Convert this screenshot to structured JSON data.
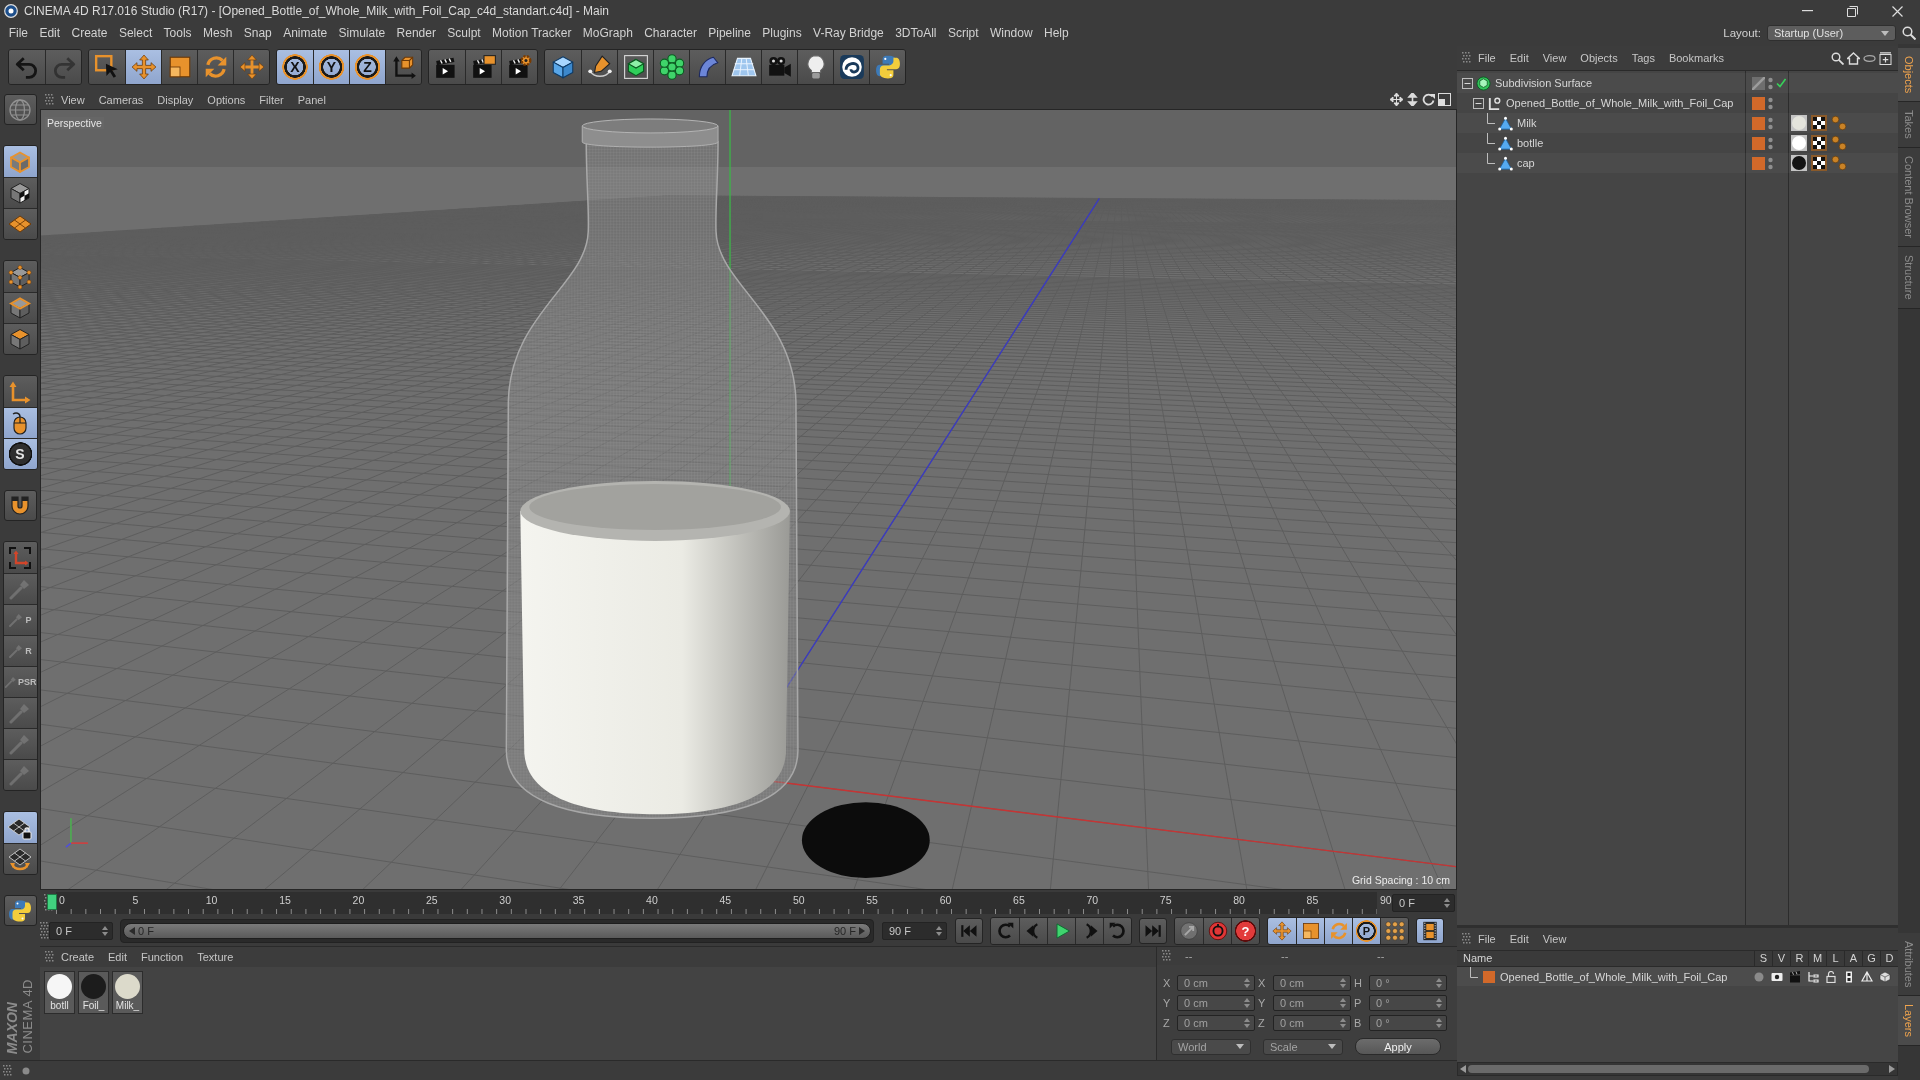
{
  "window": {
    "title": "CINEMA 4D R17.016 Studio (R17) - [Opened_Bottle_of_Whole_Milk_with_Foil_Cap_c4d_standart.c4d] - Main"
  },
  "menu_bar": {
    "items": [
      "File",
      "Edit",
      "Create",
      "Select",
      "Tools",
      "Mesh",
      "Snap",
      "Animate",
      "Simulate",
      "Render",
      "Sculpt",
      "Motion Tracker",
      "MoGraph",
      "Character",
      "Pipeline",
      "Plugins",
      "V-Ray Bridge",
      "3DToAll",
      "Script",
      "Window",
      "Help"
    ],
    "layout_label": "Layout:",
    "layout_value": "Startup (User)"
  },
  "toolbar": [
    {
      "buttons": [
        {
          "kind": "undo",
          "selected": false,
          "disabled": false
        },
        {
          "kind": "redo",
          "selected": false,
          "disabled": true
        }
      ]
    },
    {
      "buttons": [
        {
          "kind": "select",
          "selected": false,
          "disabled": false
        },
        {
          "kind": "move",
          "selected": true,
          "disabled": false
        },
        {
          "kind": "scale",
          "selected": false,
          "disabled": false
        },
        {
          "kind": "rotate",
          "selected": false,
          "disabled": false
        },
        {
          "kind": "transform",
          "selected": false,
          "disabled": false
        }
      ]
    },
    {
      "buttons": [
        {
          "kind": "axis",
          "label": "X",
          "selected": true,
          "disabled": false
        },
        {
          "kind": "axis",
          "label": "Y",
          "selected": true,
          "disabled": false
        },
        {
          "kind": "axis",
          "label": "Z",
          "selected": true,
          "disabled": false
        },
        {
          "kind": "coords",
          "selected": false,
          "disabled": false
        }
      ]
    },
    {
      "buttons": [
        {
          "kind": "render_view",
          "selected": false,
          "disabled": false
        },
        {
          "kind": "render_picture",
          "selected": false,
          "disabled": false
        },
        {
          "kind": "render_settings",
          "selected": false,
          "disabled": false
        }
      ]
    },
    {
      "buttons": [
        {
          "kind": "cube",
          "selected": false,
          "disabled": false
        },
        {
          "kind": "pen",
          "selected": false,
          "disabled": false
        },
        {
          "kind": "subdivision",
          "selected": false,
          "disabled": false
        },
        {
          "kind": "cloner",
          "selected": false,
          "disabled": false
        },
        {
          "kind": "deformer",
          "selected": false,
          "disabled": false
        },
        {
          "kind": "floor",
          "selected": false,
          "disabled": false
        },
        {
          "kind": "camera",
          "selected": false,
          "disabled": false
        },
        {
          "kind": "light",
          "selected": false,
          "disabled": false
        },
        {
          "kind": "plugin",
          "selected": false,
          "disabled": false
        },
        {
          "kind": "python",
          "selected": false,
          "disabled": false
        }
      ]
    }
  ],
  "tool_palette": [
    {
      "buttons": [
        {
          "kind": "editable",
          "selected": false,
          "disabled": true
        }
      ]
    },
    {
      "buttons": [
        {
          "kind": "model",
          "selected": true,
          "disabled": false
        },
        {
          "kind": "texture",
          "selected": false,
          "disabled": false
        },
        {
          "kind": "workplane",
          "selected": false,
          "disabled": false
        }
      ]
    },
    {
      "buttons": [
        {
          "kind": "points",
          "selected": false,
          "disabled": false
        },
        {
          "kind": "edges",
          "selected": false,
          "disabled": false
        },
        {
          "kind": "polygons",
          "selected": false,
          "disabled": false
        }
      ]
    },
    {
      "buttons": [
        {
          "kind": "axis_mode",
          "selected": false,
          "disabled": false
        },
        {
          "kind": "tweak",
          "selected": true,
          "disabled": false
        },
        {
          "kind": "solo",
          "label": "S",
          "selected": true,
          "disabled": false
        }
      ]
    },
    {
      "buttons": [
        {
          "kind": "snap",
          "selected": false,
          "disabled": false
        }
      ]
    },
    {
      "buttons": [
        {
          "kind": "workplane_axis",
          "selected": false,
          "disabled": false
        },
        {
          "kind": "brush",
          "selected": false,
          "disabled": true
        },
        {
          "kind": "brush",
          "label": "P",
          "selected": false,
          "disabled": true
        },
        {
          "kind": "brush",
          "label": "R",
          "selected": false,
          "disabled": true
        },
        {
          "kind": "brush",
          "label": "PSR",
          "selected": false,
          "disabled": true
        },
        {
          "kind": "brush",
          "selected": false,
          "disabled": true
        },
        {
          "kind": "brush",
          "selected": false,
          "disabled": true
        },
        {
          "kind": "brush",
          "selected": false,
          "disabled": true
        }
      ]
    },
    {
      "buttons": [
        {
          "kind": "lock_workplane",
          "selected": true,
          "disabled": false
        },
        {
          "kind": "planar",
          "selected": false,
          "disabled": false
        }
      ]
    },
    {
      "buttons": [
        {
          "kind": "python",
          "selected": false,
          "disabled": false
        }
      ]
    }
  ],
  "logo": {
    "brand": "MAXON",
    "product": "CINEMA 4D"
  },
  "viewport": {
    "menu": [
      "View",
      "Cameras",
      "Display",
      "Options",
      "Filter",
      "Panel"
    ],
    "camera_label": "Perspective",
    "grid_spacing": "Grid Spacing : 10 cm"
  },
  "timeline": {
    "ticks": [
      "0",
      "5",
      "10",
      "15",
      "20",
      "25",
      "30",
      "35",
      "40",
      "45",
      "50",
      "55",
      "60",
      "65",
      "70",
      "75",
      "80",
      "85",
      "90"
    ],
    "playhead": {
      "level": 0
    },
    "current_frame": "0 F",
    "start_field": "0 F",
    "range": {
      "start": "0 F",
      "end": "90 F",
      "level": 1
    },
    "end_field": "90 F",
    "transport": [
      {
        "buttons": [
          {
            "kind": "first",
            "selected": false,
            "disabled": false
          }
        ]
      },
      {
        "buttons": [
          {
            "kind": "prev_key",
            "selected": false,
            "disabled": false
          },
          {
            "kind": "prev_frame",
            "selected": false,
            "disabled": false
          },
          {
            "kind": "play",
            "selected": false,
            "disabled": false
          },
          {
            "kind": "next_frame",
            "selected": false,
            "disabled": false
          },
          {
            "kind": "next_key",
            "selected": false,
            "disabled": false
          }
        ]
      },
      {
        "buttons": [
          {
            "kind": "last",
            "selected": false,
            "disabled": false
          }
        ]
      },
      {
        "buttons": [
          {
            "kind": "motion_key",
            "selected": false,
            "disabled": true
          },
          {
            "kind": "record",
            "selected": false,
            "disabled": false
          },
          {
            "kind": "autokey",
            "label": "?",
            "selected": false,
            "disabled": false
          }
        ]
      },
      {
        "buttons": [
          {
            "kind": "move",
            "selected": true,
            "disabled": false
          },
          {
            "kind": "scale",
            "selected": true,
            "disabled": false
          },
          {
            "kind": "rotate",
            "selected": true,
            "disabled": false
          },
          {
            "kind": "param",
            "label": "P",
            "selected": true,
            "disabled": false
          },
          {
            "kind": "points_grid",
            "selected": false,
            "disabled": false
          }
        ]
      },
      {
        "buttons": [
          {
            "kind": "timeline",
            "selected": true,
            "disabled": false
          }
        ]
      }
    ]
  },
  "material_manager": {
    "menu": [
      "Create",
      "Edit",
      "Function",
      "Texture"
    ],
    "materials": [
      {
        "name": "botll",
        "color": "#f6f6f6"
      },
      {
        "name": "Foil_",
        "color": "#1c1c1c"
      },
      {
        "name": "Milk_",
        "color": "#dcdacb"
      }
    ]
  },
  "coordinates": {
    "disabled": true,
    "columns": [
      {
        "header": "--",
        "fields": [
          {
            "label": "X",
            "value": "0 cm"
          },
          {
            "label": "Y",
            "value": "0 cm"
          },
          {
            "label": "Z",
            "value": "0 cm"
          }
        ]
      },
      {
        "header": "--",
        "fields": [
          {
            "label": "X",
            "value": "0 cm"
          },
          {
            "label": "Y",
            "value": "0 cm"
          },
          {
            "label": "Z",
            "value": "0 cm"
          }
        ]
      },
      {
        "header": "--",
        "fields": [
          {
            "label": "H",
            "value": "0 °"
          },
          {
            "label": "P",
            "value": "0 °"
          },
          {
            "label": "B",
            "value": "0 °"
          }
        ]
      }
    ],
    "mode": "World",
    "transform": "Scale",
    "apply": "Apply"
  },
  "object_manager": {
    "menu": [
      "File",
      "Edit",
      "View",
      "Objects",
      "Tags",
      "Bookmarks"
    ],
    "objects": [
      {
        "name": "Subdivision Surface",
        "kind": "generator",
        "expanded": true,
        "layer": false,
        "enabled": true,
        "selected": false,
        "children": [
          {
            "name": "Opened_Bottle_of_Whole_Milk_with_Foil_Cap",
            "kind": "null",
            "expanded": true,
            "layer": true,
            "selected": false,
            "children": [
              {
                "name": "Milk",
                "kind": "polygon",
                "layer": true,
                "selected": false,
                "tags": [
                  {
                    "kind": "material",
                    "color": "#e4e4dc"
                  },
                  {
                    "kind": "texture"
                  },
                  {
                    "kind": "phong"
                  }
                ]
              },
              {
                "name": "botlle",
                "kind": "polygon",
                "layer": true,
                "selected": false,
                "tags": [
                  {
                    "kind": "material",
                    "color": "#ffffff"
                  },
                  {
                    "kind": "texture"
                  },
                  {
                    "kind": "phong"
                  }
                ]
              },
              {
                "name": "cap",
                "kind": "polygon",
                "layer": true,
                "selected": false,
                "tags": [
                  {
                    "kind": "material",
                    "color": "#141414"
                  },
                  {
                    "kind": "texture"
                  },
                  {
                    "kind": "phong"
                  }
                ]
              }
            ]
          }
        ]
      }
    ]
  },
  "layer_manager": {
    "menu": [
      "File",
      "Edit",
      "View"
    ],
    "columns": [
      "Name",
      "S",
      "V",
      "R",
      "M",
      "L",
      "A",
      "G",
      "D"
    ],
    "layers": [
      {
        "name": "Opened_Bottle_of_Whole_Milk_with_Foil_Cap",
        "color": "#d2692a",
        "solo": false,
        "view": true,
        "render": true,
        "manager": true,
        "locked": false,
        "animation": true,
        "generators": true,
        "deformers": true
      }
    ]
  },
  "side_tabs": {
    "top": [
      {
        "label": "Objects",
        "selected": true
      },
      {
        "label": "Takes",
        "selected": false
      },
      {
        "label": "Content Browser",
        "selected": false
      },
      {
        "label": "Structure",
        "selected": false
      }
    ],
    "bottom": [
      {
        "label": "Attributes",
        "selected": false
      },
      {
        "label": "Layers",
        "selected": true
      }
    ]
  }
}
